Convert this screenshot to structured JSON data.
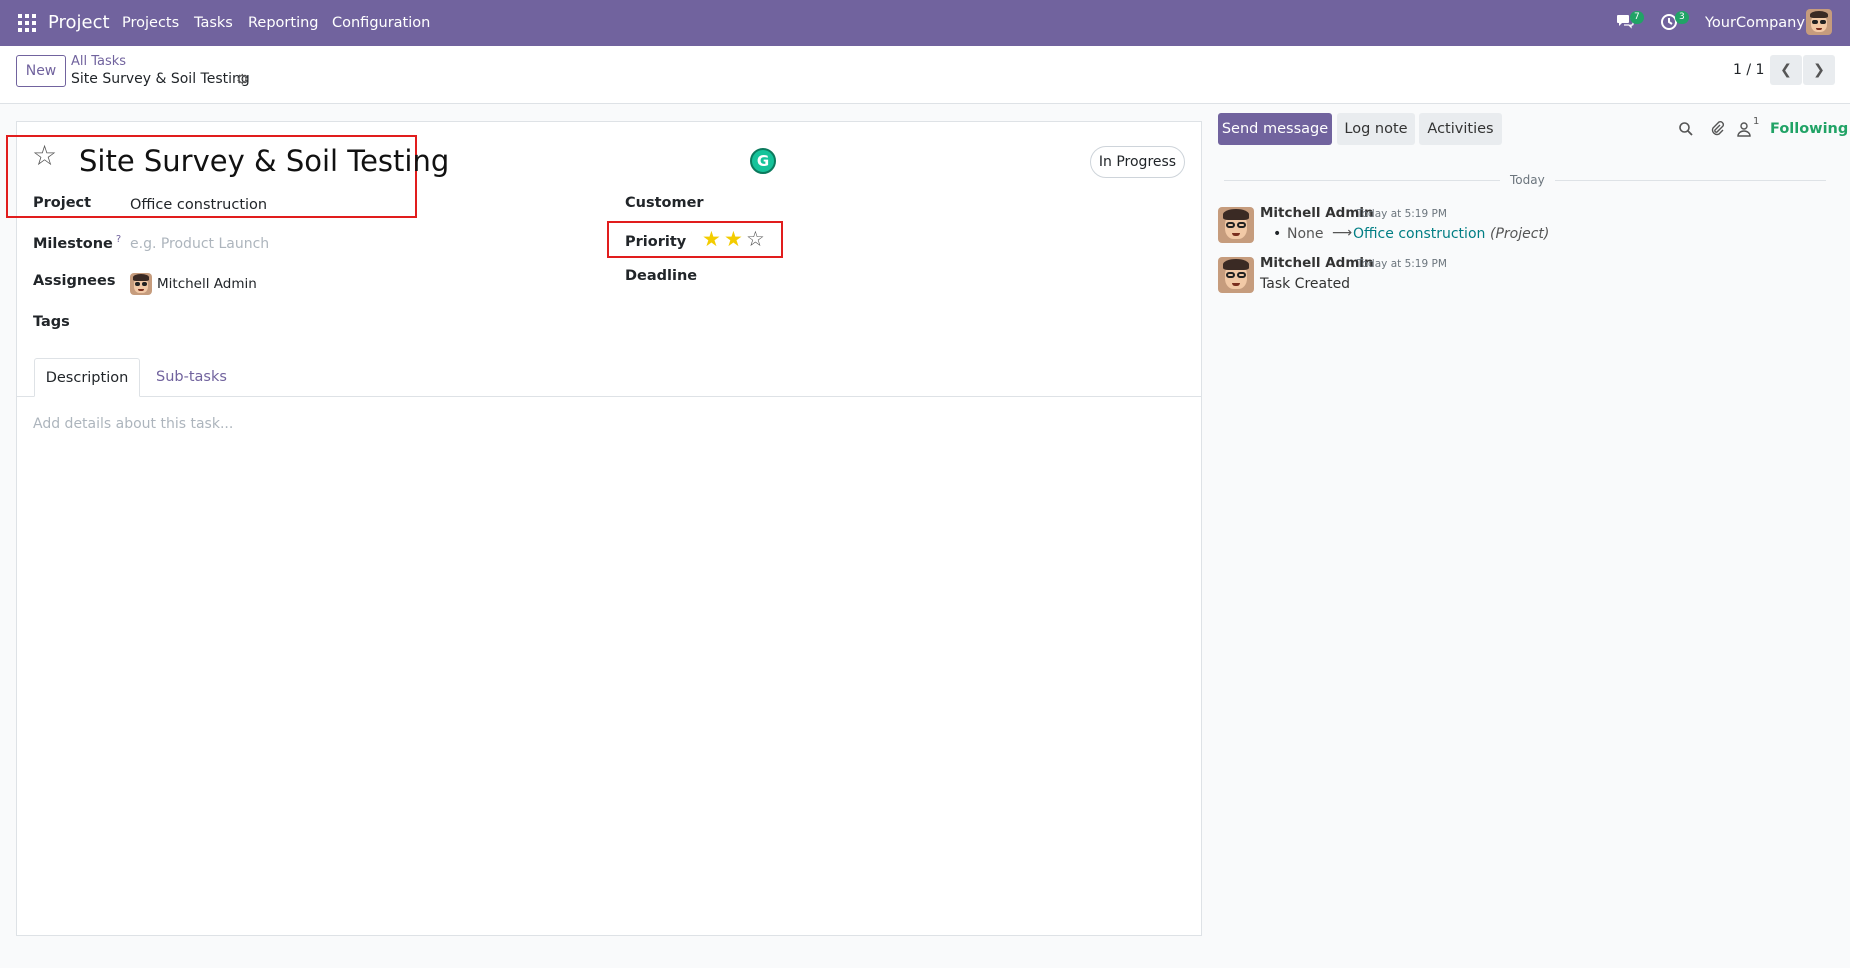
{
  "app": {
    "name": "Project",
    "menu": [
      "Projects",
      "Tasks",
      "Reporting",
      "Configuration"
    ],
    "company": "YourCompany",
    "chat_badge": "7",
    "activity_badge": "3"
  },
  "control": {
    "new_label": "New",
    "breadcrumb_parent": "All Tasks",
    "breadcrumb_current": "Site Survey & Soil Testing",
    "pager": "1 / 1"
  },
  "task": {
    "title": "Site Survey & Soil Testing",
    "status": "In Progress",
    "project_label": "Project",
    "project_value": "Office construction",
    "milestone_label": "Milestone",
    "milestone_help": "?",
    "milestone_placeholder": "e.g. Product Launch",
    "assignees_label": "Assignees",
    "assignee": "Mitchell Admin",
    "tags_label": "Tags",
    "customer_label": "Customer",
    "priority_label": "Priority",
    "priority_stars": 2,
    "priority_max": 3,
    "deadline_label": "Deadline",
    "tabs": [
      "Description",
      "Sub-tasks"
    ],
    "description_placeholder": "Add details about this task..."
  },
  "chatter": {
    "send_message": "Send message",
    "log_note": "Log note",
    "activities": "Activities",
    "followers_count": "1",
    "following": "Following",
    "today": "Today",
    "messages": [
      {
        "author": "Mitchell Admin",
        "time": "Today at 5:19 PM",
        "bullet_old": "None",
        "bullet_arrow": "⟶",
        "bullet_new": "Office construction",
        "bullet_field": "(Project)"
      },
      {
        "author": "Mitchell Admin",
        "time": "Today at 5:19 PM",
        "body": "Task Created"
      }
    ]
  },
  "colors": {
    "brand": "#71639e",
    "success": "#21a366",
    "star": "#f3cc00",
    "highlight": "#e11d1d"
  }
}
